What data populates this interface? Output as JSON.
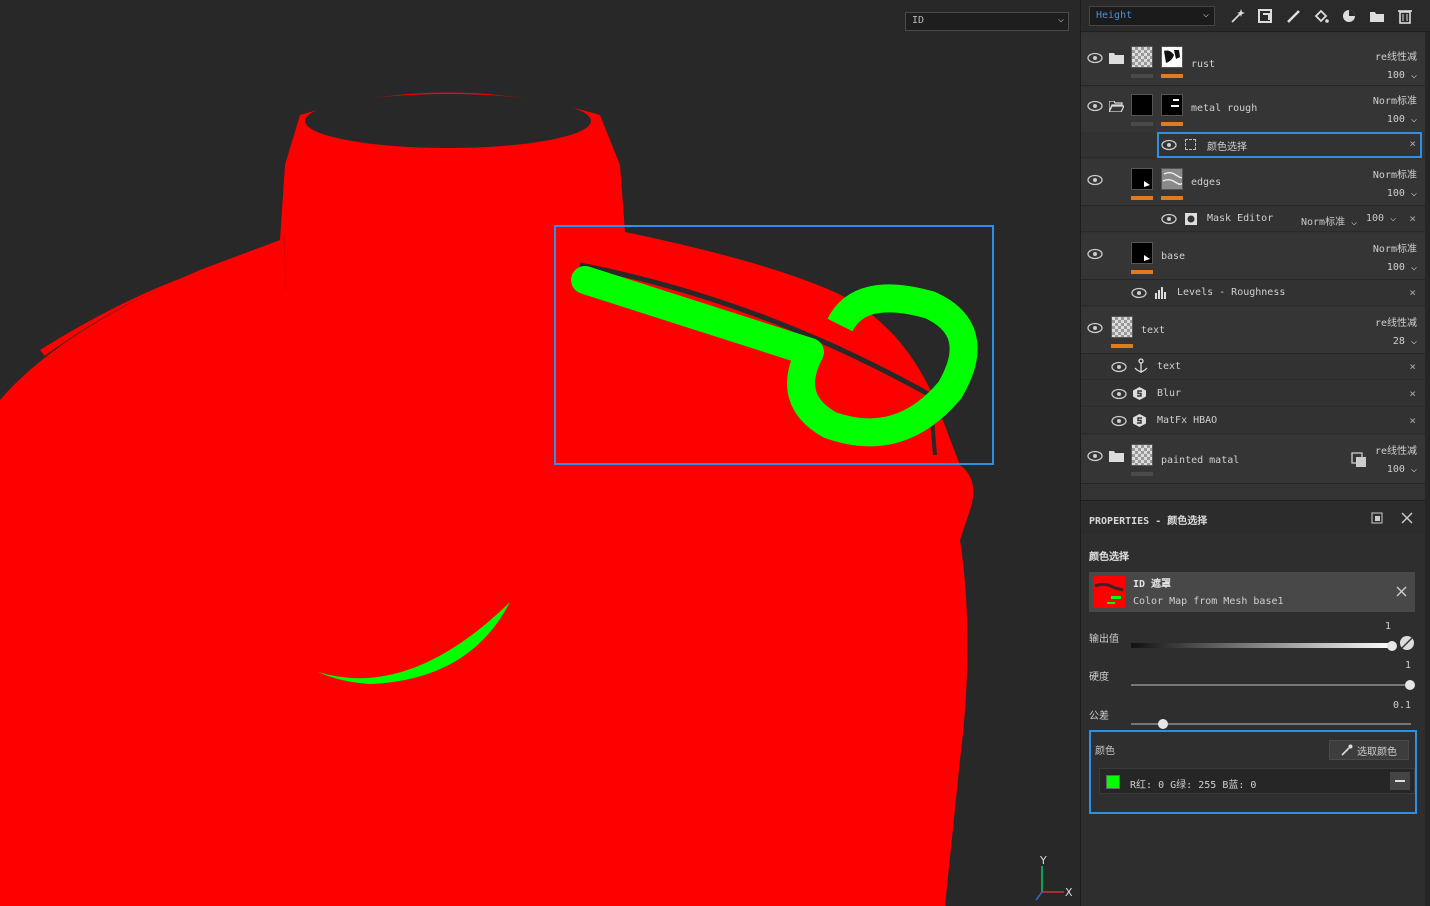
{
  "viewport": {
    "display_select": "ID",
    "axis": {
      "y": "Y",
      "x": "X"
    },
    "colors": {
      "background": "#282828",
      "mesh_red": "#ff0000",
      "id_green": "#00ff00",
      "highlight": "#2e8fe6"
    }
  },
  "toolbar": {
    "channel_select": "Height",
    "icons": [
      "magic-wand-icon",
      "refresh-layer-icon",
      "brush-icon",
      "fill-icon",
      "material-icon",
      "folder-icon",
      "trash-icon"
    ]
  },
  "layers": [
    {
      "name": "rust",
      "blend": "re线性减",
      "opacity": "100",
      "highlighted": true
    },
    {
      "name": "metal rough",
      "blend": "Norm标准",
      "opacity": "100",
      "sub": [
        {
          "name": "颜色选择",
          "selected": true
        }
      ]
    },
    {
      "name": "edges",
      "blend": "Norm标准",
      "opacity": "100",
      "sub": [
        {
          "name": "Mask Editor",
          "blend": "Norm标准",
          "opacity": "100"
        }
      ]
    },
    {
      "name": "base",
      "blend": "Norm标准",
      "opacity": "100",
      "sub": [
        {
          "name": "Levels - Roughness"
        }
      ]
    },
    {
      "name": "text",
      "blend": "re线性减",
      "opacity": "28",
      "sub": [
        {
          "name": "text"
        },
        {
          "name": "Blur"
        },
        {
          "name": "MatFx HBAO"
        }
      ]
    },
    {
      "name": "painted matal",
      "blend": "re线性减",
      "opacity": "100"
    }
  ],
  "properties": {
    "header": "PROPERTIES - 颜色选择",
    "section_title": "颜色选择",
    "id_card": {
      "title": "ID 遮罩",
      "subtitle": "Color Map from Mesh base1"
    },
    "sliders": [
      {
        "label": "输出值",
        "value": "1",
        "fraction": 1.0
      },
      {
        "label": "硬度",
        "value": "1",
        "fraction": 1.0
      },
      {
        "label": "公差",
        "value": "0.1",
        "fraction": 0.1
      }
    ],
    "color": {
      "label": "颜色",
      "pick_button": "选取颜色",
      "swatch": "#00ff00",
      "r_label": "R红:",
      "r": "0",
      "g_label": "G绿:",
      "g": "255",
      "b_label": "B蓝:",
      "b": "0"
    }
  }
}
